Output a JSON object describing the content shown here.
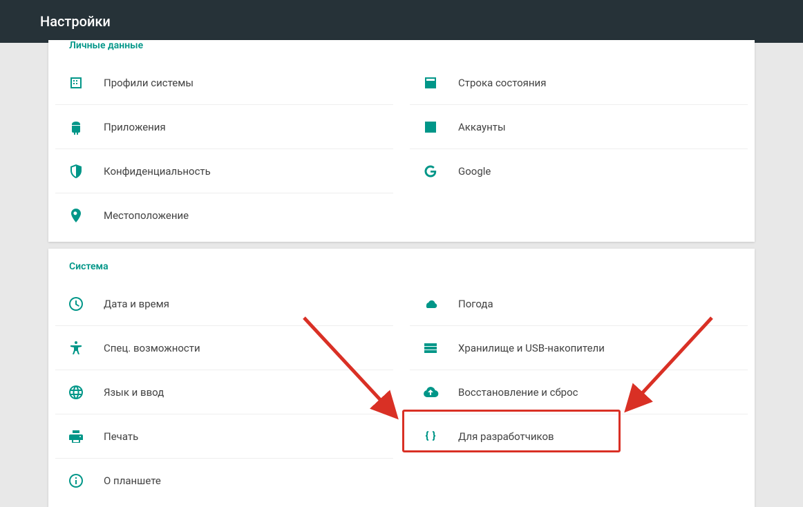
{
  "header": {
    "title": "Настройки"
  },
  "sections": {
    "personal": {
      "title": "Личные данные",
      "left": [
        {
          "id": "profiles",
          "label": "Профили системы"
        },
        {
          "id": "apps",
          "label": "Приложения"
        },
        {
          "id": "privacy",
          "label": "Конфиденциальность"
        },
        {
          "id": "location",
          "label": "Местоположение"
        }
      ],
      "right": [
        {
          "id": "statusbar",
          "label": "Строка состояния"
        },
        {
          "id": "accounts",
          "label": "Аккаунты"
        },
        {
          "id": "google",
          "label": "Google"
        }
      ]
    },
    "system": {
      "title": "Система",
      "left": [
        {
          "id": "datetime",
          "label": "Дата и время"
        },
        {
          "id": "accessibility",
          "label": "Спец. возможности"
        },
        {
          "id": "language",
          "label": "Язык и ввод"
        },
        {
          "id": "print",
          "label": "Печать"
        },
        {
          "id": "about",
          "label": "О планшете"
        }
      ],
      "right": [
        {
          "id": "weather",
          "label": "Погода"
        },
        {
          "id": "storage",
          "label": "Хранилище и USB-накопители"
        },
        {
          "id": "backup",
          "label": "Восстановление и сброс"
        },
        {
          "id": "developer",
          "label": "Для разработчиков"
        }
      ]
    }
  }
}
